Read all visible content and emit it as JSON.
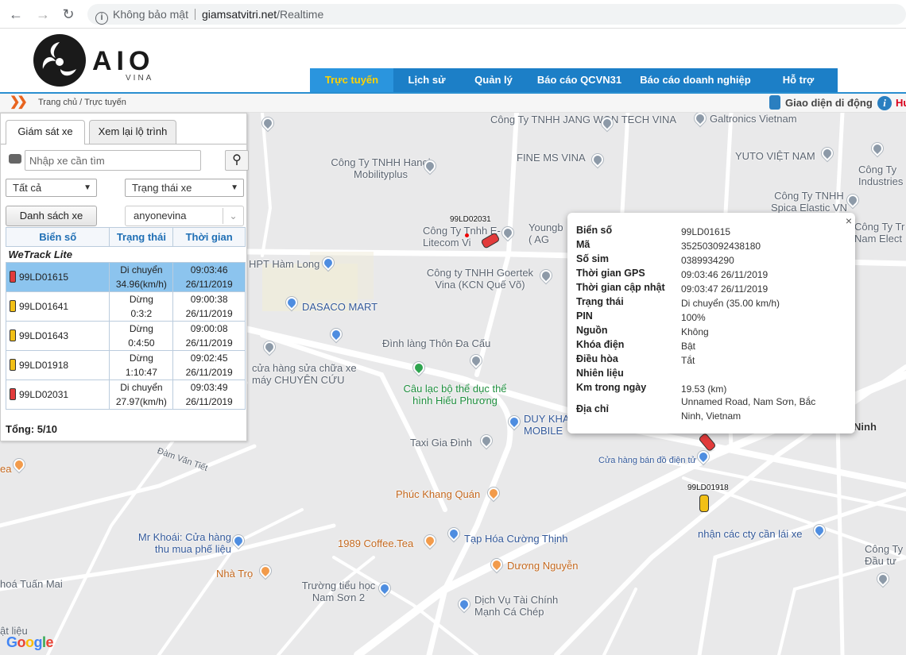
{
  "browser": {
    "security_label": "Không bảo mật",
    "url_host": "giamsatvitri.net",
    "url_path": "/Realtime"
  },
  "header": {
    "logo_text": "AIO",
    "logo_sub": "VINA",
    "menu": [
      {
        "label": "Trực tuyến",
        "active": true
      },
      {
        "label": "Lịch sử"
      },
      {
        "label": "Quản lý"
      },
      {
        "label": "Báo cáo QCVN31"
      },
      {
        "label": "Báo cáo doanh nghiệp"
      },
      {
        "label": "Hỗ trợ"
      }
    ]
  },
  "breadcrumb": {
    "text": "Trang chủ / Trực tuyến",
    "mobile_label": "Giao diện di động",
    "help_label": "Hư"
  },
  "panel": {
    "tabs": [
      "Giám sát xe",
      "Xem lại lộ trình"
    ],
    "search_placeholder": "Nhập xe cần tìm",
    "filter_all": "Tất cả",
    "filter_status": "Trạng thái xe",
    "list_button": "Danh sách xe",
    "user_select": "anyonevina",
    "columns": [
      "Biển số",
      "Trạng thái",
      "Thời gian"
    ],
    "group": "WeTrack Lite",
    "vehicles": [
      {
        "plate": "99LD01615",
        "status1": "Di chuyển",
        "status2": "34.96(km/h)",
        "time": "09:03:46",
        "date": "26/11/2019",
        "color": "red"
      },
      {
        "plate": "99LD01641",
        "status1": "Dừng",
        "status2": "0:3:2",
        "time": "09:00:38",
        "date": "26/11/2019",
        "color": "yellow"
      },
      {
        "plate": "99LD01643",
        "status1": "Dừng",
        "status2": "0:4:50",
        "time": "09:00:08",
        "date": "26/11/2019",
        "color": "yellow"
      },
      {
        "plate": "99LD01918",
        "status1": "Dừng",
        "status2": "1:10:47",
        "time": "09:02:45",
        "date": "26/11/2019",
        "color": "yellow"
      },
      {
        "plate": "99LD02031",
        "status1": "Di chuyển",
        "status2": "27.97(km/h)",
        "time": "09:03:49",
        "date": "26/11/2019",
        "color": "red"
      }
    ],
    "total": "Tổng: 5/10"
  },
  "popup": {
    "close": "×",
    "rows": [
      {
        "key": "Biển số",
        "value": "99LD01615"
      },
      {
        "key": "Mã",
        "value": "352503092438180"
      },
      {
        "key": "Số sim",
        "value": "0389934290"
      },
      {
        "key": "Thời gian GPS",
        "value": "09:03:46 26/11/2019"
      },
      {
        "key": "Thời gian cập nhật",
        "value": "09:03:47 26/11/2019"
      },
      {
        "key": "Trạng thái",
        "value": "Di chuyển (35.00 km/h)"
      },
      {
        "key": "PIN",
        "value": "100%"
      },
      {
        "key": "Nguồn",
        "value": "Không"
      },
      {
        "key": "Khóa điện",
        "value": "Bật"
      },
      {
        "key": "Điều hòa",
        "value": "Tắt"
      },
      {
        "key": "Nhiên liệu",
        "value": ""
      },
      {
        "key": "Km trong ngày",
        "value": "19.53 (km)"
      },
      {
        "key": "Địa chỉ",
        "value": "Unnamed Road, Nam Sơn, Bắc Ninh, Vietnam"
      }
    ]
  },
  "map": {
    "car_labels": [
      "99LD02031",
      "99LD01918"
    ],
    "pois": [
      "Công Ty TNHH JANG WON TECH VINA",
      "Galtronics Vietnam",
      "Công Ty TNHH Hanoi Mobilityplus",
      "FINE MS VINA",
      "YUTO VIỆT NAM",
      "Công Ty Industries",
      "Công Ty TNHH Spica Elastic VN",
      "Công Ty Tr Nam Elect",
      "Công Ty Tnhh E-Litecom Vi",
      "Youngb ( AG",
      "HPT Hàm Long",
      "Công ty TNHH Goertek Vina (KCN Quế Võ)",
      "DASACO MART",
      "Đình làng Thôn Đa Cấu",
      "cửa hàng sửa chữa xe máy CHUYÊN CỨU",
      "Câu lạc bộ thể dục thể hình Hiếu Phương",
      "DUY KHA MOBILE",
      "Ninh",
      "Taxi Gia Đình",
      "Cửa hàng bán đồ điện tử",
      "Đàm Văn Tiết",
      "ea",
      "Phúc Khang Quán",
      "Mr Khoái: Cửa hàng thu mua phế liệu",
      "1989 Coffee.Tea",
      "Tạp Hóa Cường Thịnh",
      "nhận các cty cần lái xe",
      "Nhà Trọ",
      "Dương Nguyễn",
      "Công Ty Đầu tư",
      "hoá Tuấn Mai",
      "Trường tiểu học Nam Sơn 2",
      "Dịch Vụ Tài Chính Mạnh Cá Chép",
      "ật liệu",
      "Google"
    ]
  }
}
